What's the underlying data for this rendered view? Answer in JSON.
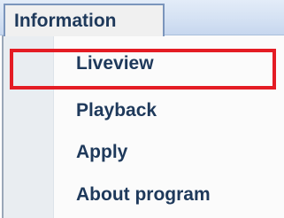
{
  "menu": {
    "title": "Information",
    "items": [
      {
        "label": "Liveview",
        "highlighted": true
      },
      {
        "label": "Playback"
      },
      {
        "label": "Apply"
      },
      {
        "label": "About program"
      }
    ]
  },
  "colors": {
    "text": "#1e395b",
    "highlight_border": "#e41c24",
    "menubar": "#d4e1f3"
  }
}
